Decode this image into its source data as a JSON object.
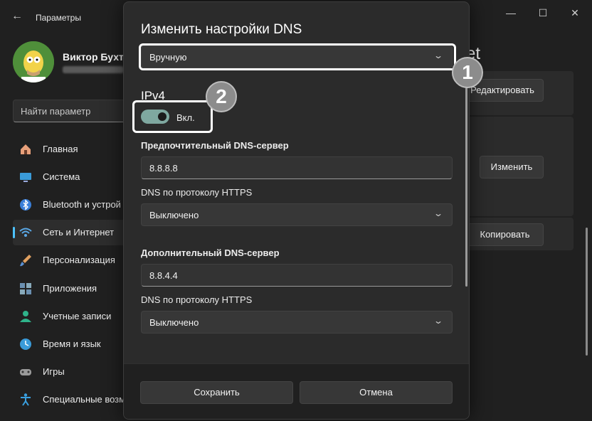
{
  "window": {
    "back_glyph": "←",
    "title": "Параметры",
    "controls": {
      "minimize": "—",
      "maximize": "☐",
      "close": "✕"
    }
  },
  "user": {
    "name": "Виктор Бухте"
  },
  "search": {
    "placeholder": "Найти параметр"
  },
  "sidebar": {
    "items": [
      {
        "label": "Главная",
        "icon": "home-icon",
        "color": "#e8a07a"
      },
      {
        "label": "Система",
        "icon": "monitor-icon",
        "color": "#3a9bd9"
      },
      {
        "label": "Bluetooth и устрой",
        "icon": "bluetooth-icon",
        "color": "#3a7fd9"
      },
      {
        "label": "Сеть и Интернет",
        "icon": "wifi-icon",
        "color": "#5aa8e6",
        "active": true
      },
      {
        "label": "Персонализация",
        "icon": "brush-icon",
        "color": "#e0a060"
      },
      {
        "label": "Приложения",
        "icon": "apps-icon",
        "color": "#6a8fb0"
      },
      {
        "label": "Учетные записи",
        "icon": "person-icon",
        "color": "#2fb38a"
      },
      {
        "label": "Время и язык",
        "icon": "globe-clock-icon",
        "color": "#3a9bd9"
      },
      {
        "label": "Игры",
        "icon": "gamepad-icon",
        "color": "#9a9a9a"
      },
      {
        "label": "Специальные возм",
        "icon": "accessibility-icon",
        "color": "#3aa0e0"
      }
    ]
  },
  "background": {
    "heading_tail": "et",
    "edit_button": "Редактировать",
    "change_button": "Изменить",
    "copy_button": "Копировать"
  },
  "dialog": {
    "title": "Изменить настройки DNS",
    "mode_select": "Вручную",
    "section_title": "IPv4",
    "toggle_label": "Вкл.",
    "toggle_on": true,
    "preferred_label": "Предпочтительный DNS-сервер",
    "preferred_value": "8.8.8.8",
    "https_label_1": "DNS по протоколу HTTPS",
    "https_value_1": "Выключено",
    "alternate_label": "Дополнительный DNS-сервер",
    "alternate_value": "8.8.4.4",
    "https_label_2": "DNS по протоколу HTTPS",
    "https_value_2": "Выключено",
    "save_button": "Сохранить",
    "cancel_button": "Отмена",
    "chevron_glyph": "⌄"
  },
  "annotations": {
    "badge_1": "1",
    "badge_2": "2"
  },
  "colors": {
    "accent": "#4cc2ff",
    "dialog_bg": "#2b2b2b",
    "window_bg": "#202020"
  }
}
